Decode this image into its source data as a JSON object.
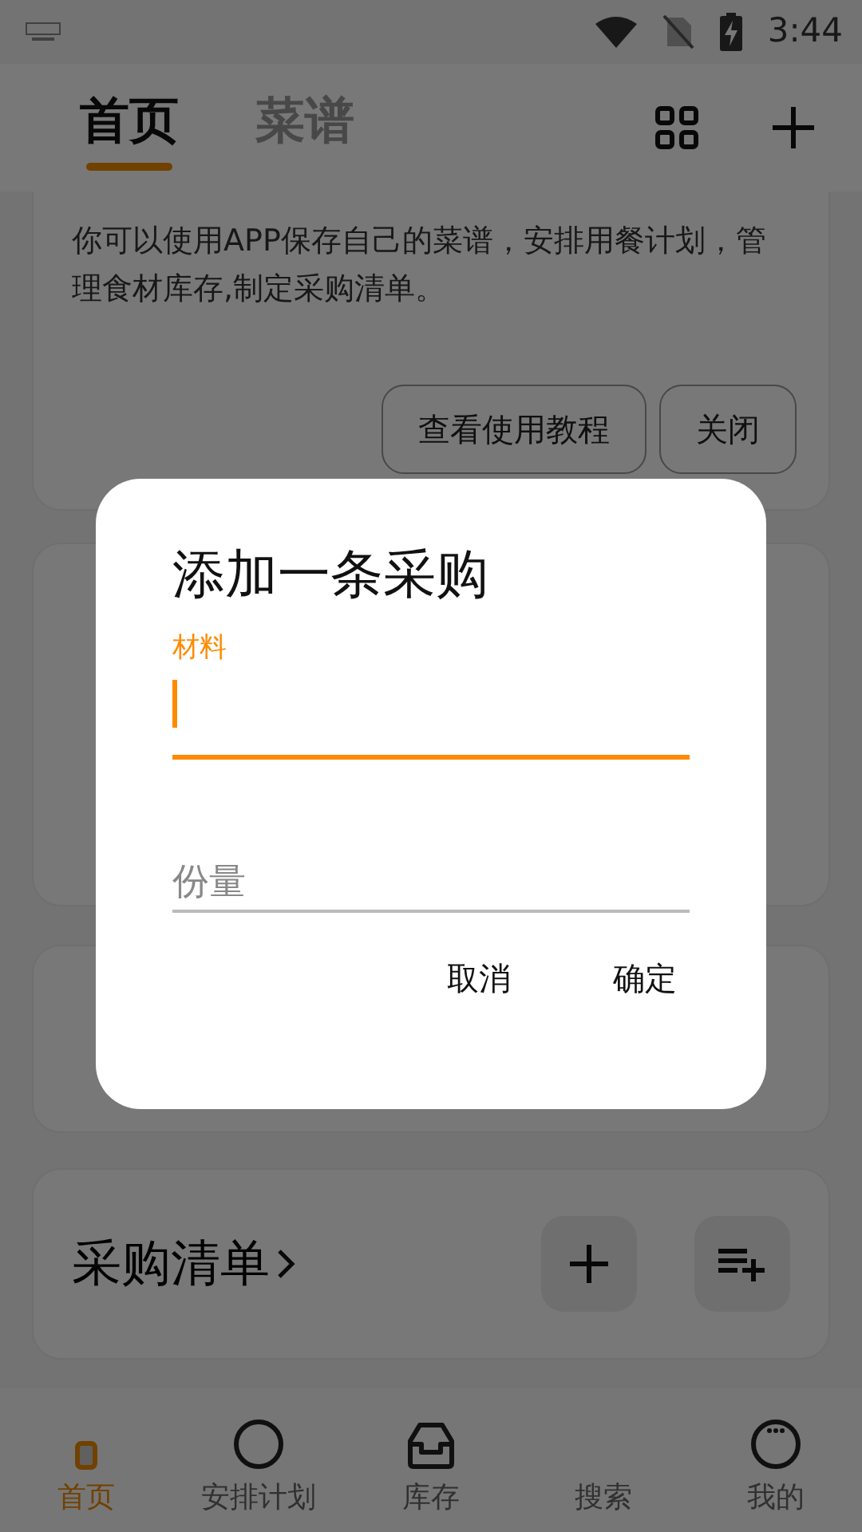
{
  "status_bar": {
    "time": "3:44"
  },
  "tabs": [
    {
      "label": "首页",
      "selected": true
    },
    {
      "label": "菜谱",
      "selected": false
    }
  ],
  "welcome_card": {
    "description": "你可以使用APP保存自己的菜谱，安排用餐计划，管理食材库存,制定采购清单。",
    "buttons": [
      "查看使用教程",
      "关闭"
    ]
  },
  "shopping_card": {
    "title": "采购清单"
  },
  "dialog": {
    "title": "添加一条采购",
    "fields": [
      {
        "label": "材料",
        "focused": true
      },
      {
        "label": "份量",
        "focused": false
      }
    ],
    "buttons": [
      "取消",
      "确定"
    ]
  },
  "bottom_nav": [
    {
      "label": "首页",
      "kind": "home",
      "selected": true
    },
    {
      "label": "安排计划",
      "kind": "circle",
      "selected": false
    },
    {
      "label": "库存",
      "kind": "inbox",
      "selected": false
    },
    {
      "label": "搜索",
      "kind": "blank",
      "selected": false
    },
    {
      "label": "我的",
      "kind": "more",
      "selected": false
    }
  ]
}
